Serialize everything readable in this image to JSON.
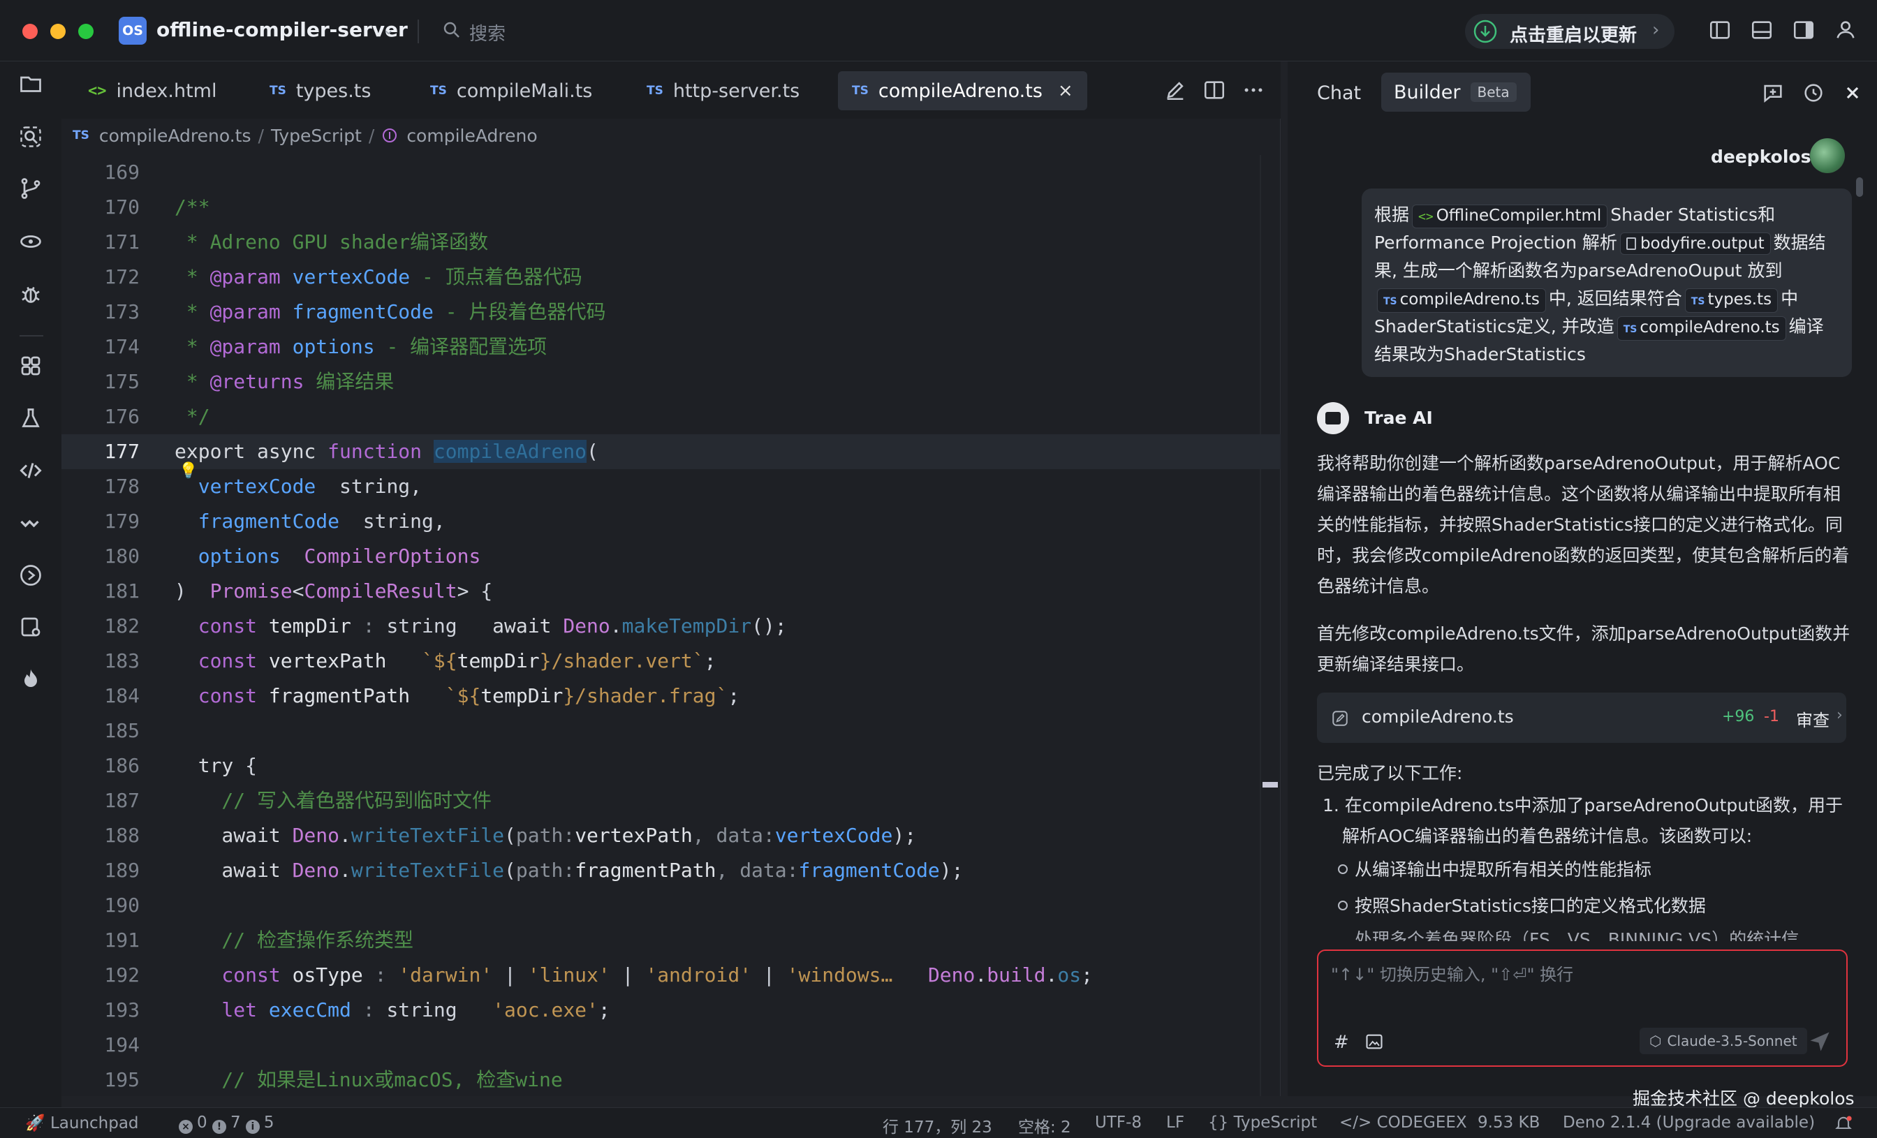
{
  "titlebar": {
    "project_badge": "OS",
    "project_name": "offline-compiler-server",
    "search_placeholder": "搜索",
    "update_label": "点击重启以更新"
  },
  "editor": {
    "tabs": [
      {
        "label": "index.html",
        "kind": "html",
        "active": false
      },
      {
        "label": "types.ts",
        "kind": "ts",
        "active": false
      },
      {
        "label": "compileMali.ts",
        "kind": "ts",
        "active": false
      },
      {
        "label": "http-server.ts",
        "kind": "ts",
        "active": false
      },
      {
        "label": "compileAdreno.ts",
        "kind": "ts",
        "active": true
      }
    ],
    "ts_badge": "TS",
    "breadcrumb": {
      "file": "compileAdreno.ts",
      "language": "TypeScript",
      "symbol": "compileAdreno"
    },
    "current_line": 177,
    "lines": [
      {
        "n": "169"
      },
      {
        "n": "170"
      },
      {
        "n": "171"
      },
      {
        "n": "172"
      },
      {
        "n": "173"
      },
      {
        "n": "174"
      },
      {
        "n": "175"
      },
      {
        "n": "176"
      },
      {
        "n": "177"
      },
      {
        "n": "178"
      },
      {
        "n": "179"
      },
      {
        "n": "180"
      },
      {
        "n": "181"
      },
      {
        "n": "182"
      },
      {
        "n": "183"
      },
      {
        "n": "184"
      },
      {
        "n": "185"
      },
      {
        "n": "186"
      },
      {
        "n": "187"
      },
      {
        "n": "188"
      },
      {
        "n": "189"
      },
      {
        "n": "190"
      },
      {
        "n": "191"
      },
      {
        "n": "192"
      },
      {
        "n": "193"
      },
      {
        "n": "194"
      },
      {
        "n": "195"
      }
    ]
  },
  "chat": {
    "tab_chat": "Chat",
    "tab_builder": "Builder",
    "beta": "Beta",
    "user_name": "deepkolos",
    "user_message": {
      "p1": "根据",
      "chip_html": "OfflineCompiler.html",
      "p2": "Shader Statistics和 Performance Projection 解析",
      "chip_output": "bodyfire.output",
      "p3": "数据结果, 生成一个解析函数名为parseAdrenoOuput 放到",
      "chip_ts1": "compileAdreno.ts",
      "p4": "中, 返回结果符合",
      "chip_ts2": "types.ts",
      "p5": "中 ShaderStatistics定义, 并改造",
      "chip_ts3": "compileAdreno.ts",
      "p6": "编译结果改为ShaderStatistics"
    },
    "ai_name": "Trae AI",
    "ai_para1": "我将帮助你创建一个解析函数parseAdrenoOutput，用于解析AOC编译器输出的着色器统计信息。这个函数将从编译输出中提取所有相关的性能指标，并按照ShaderStatistics接口的定义进行格式化。同时，我会修改compileAdreno函数的返回类型，使其包含解析后的着色器统计信息。",
    "ai_para2": "首先修改compileAdreno.ts文件，添加parseAdrenoOutput函数并更新编译结果接口。",
    "file_card": {
      "name": "compileAdreno.ts",
      "added": "+96",
      "removed": "-1",
      "review": "审查"
    },
    "done_title": "已完成了以下工作:",
    "done_item1": "1. 在compileAdreno.ts中添加了parseAdrenoOutput函数，用于解析AOC编译器输出的着色器统计信息。该函数可以:",
    "sub_items": [
      "从编译输出中提取所有相关的性能指标",
      "按照ShaderStatistics接口的定义格式化数据"
    ],
    "cut_line": "处理多个着色器阶段（FS、VS、BINNING VS）的统计信",
    "input_placeholder": "\"↑↓\" 切换历史输入, \"⇧⏎\" 换行",
    "model": "Claude-3.5-Sonnet"
  },
  "statusbar": {
    "launchpad": "Launchpad",
    "errors": "0",
    "warnings": "7",
    "infos": "5",
    "cursor": "行 177，列 23",
    "spaces": "空格: 2",
    "encoding": "UTF-8",
    "eol": "LF",
    "language": "TypeScript",
    "codegeex": "CODEGEEX",
    "size": "9.53 KB",
    "deno": "Deno 2.1.4 (Upgrade available)"
  },
  "watermark": "掘金技术社区 @ deepkolos"
}
